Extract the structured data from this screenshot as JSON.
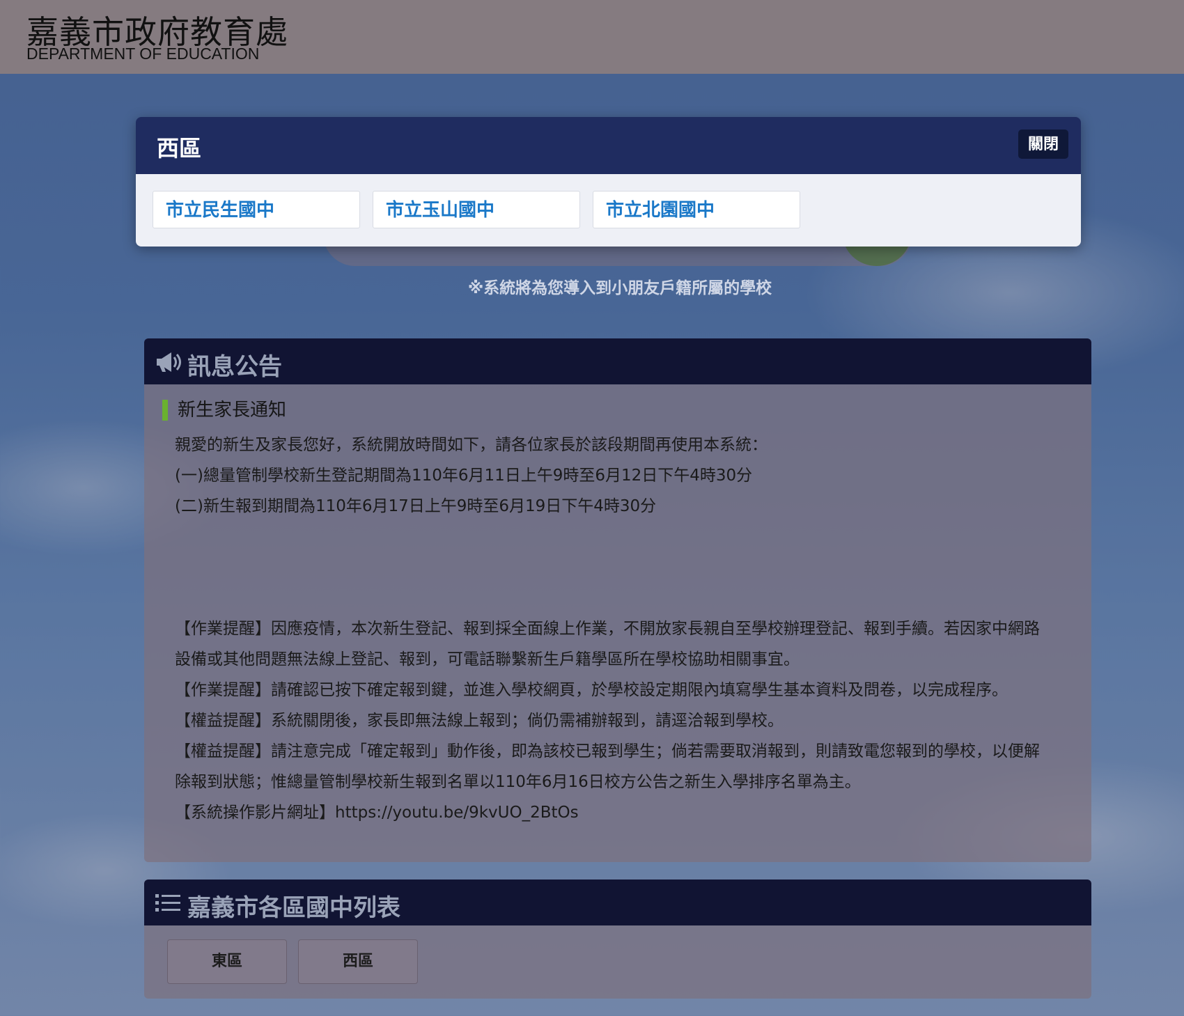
{
  "header": {
    "title": "嘉義市政府教育處",
    "subtitle": "DEPARTMENT OF EDUCATION"
  },
  "search": {
    "hint": "※系統將為您導入到小朋友戶籍所屬的學校"
  },
  "modal": {
    "title": "西區",
    "close_label": "關閉",
    "schools": [
      "市立民生國中",
      "市立玉山國中",
      "市立北園國中"
    ]
  },
  "announcements": {
    "header": "訊息公告",
    "icon": "megaphone-icon",
    "notice_title": "新生家長通知",
    "lines": [
      "親愛的新生及家長您好，系統開放時間如下，請各位家長於該段期間再使用本系統：",
      "(一)總量管制學校新生登記期間為110年6月11日上午9時至6月12日下午4時30分",
      "(二)新生報到期間為110年6月17日上午9時至6月19日下午4時30分"
    ],
    "reminders": [
      "【作業提醒】因應疫情，本次新生登記、報到採全面線上作業，不開放家長親自至學校辦理登記、報到手續。若因家中網路",
      "設備或其他問題無法線上登記、報到，可電話聯繫新生戶籍學區所在學校協助相關事宜。",
      "【作業提醒】請確認已按下確定報到鍵，並進入學校網頁，於學校設定期限內填寫學生基本資料及問卷，以完成程序。",
      "【權益提醒】系統關閉後，家長即無法線上報到；倘仍需補辦報到，請逕洽報到學校。",
      "【權益提醒】請注意完成「確定報到」動作後，即為該校已報到學生；倘若需要取消報到，則請致電您報到的學校，以便解",
      "除報到狀態；惟總量管制學校新生報到名單以110年6月16日校方公告之新生入學排序名單為主。",
      "【系統操作影片網址】https://youtu.be/9kvUO_2BtOs"
    ]
  },
  "school_list": {
    "header": "嘉義市各區國中列表",
    "icon": "list-icon",
    "zones": [
      "東區",
      "西區"
    ]
  }
}
